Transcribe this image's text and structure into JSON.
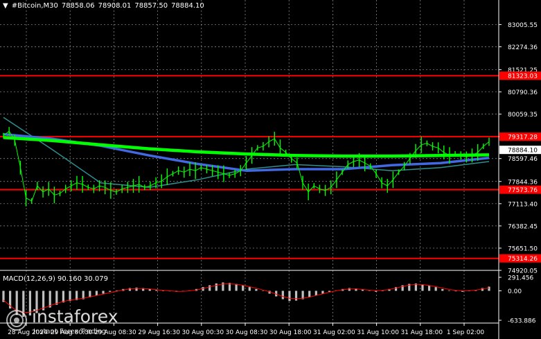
{
  "header": {
    "symbol": "#Bitcoin,M30",
    "open": "78858.06",
    "high": "78908.01",
    "low": "78857.50",
    "close": "78884.10"
  },
  "macd_header": {
    "name": "MACD(12,26,9)",
    "main": "90.160",
    "signal": "30.079"
  },
  "watermark": {
    "brand": "instaforex",
    "tagline": "Instant Forex Trading"
  },
  "colors": {
    "background": "#000000",
    "grid": "#ffffff",
    "price_line": "#00ff00",
    "level_line": "#ff0000",
    "level_label_bg": "#ff0000",
    "current_label_bg": "#ffffff",
    "ma_fast": "#00ff00",
    "ma_slow": "#4169e1",
    "ma_teal": "#2f8f8f",
    "macd_hist": "#c0c0c0",
    "macd_signal": "#ff0000"
  },
  "chart_data": [
    {
      "type": "line",
      "title": "#Bitcoin,M30",
      "ylim": [
        74920.05,
        83700
      ],
      "y_ticks": [
        "83005.55",
        "82274.36",
        "81521.25",
        "80790.36",
        "80059.35",
        "79317.28",
        "78597.46",
        "77844.36",
        "77113.40",
        "76382.45",
        "75651.50",
        "74920.05"
      ],
      "x_ticks": [
        "28 Aug 2024",
        "29 Aug 00:30",
        "29 Aug 08:30",
        "29 Aug 16:30",
        "30 Aug 00:30",
        "30 Aug 08:30",
        "30 Aug 18:00",
        "31 Aug 02:00",
        "31 Aug 10:00",
        "31 Aug 18:00",
        "1 Sep 02:00"
      ],
      "levels": [
        {
          "label": "81323.03",
          "value": 81323.03
        },
        {
          "label": "79317.28",
          "value": 79317.28
        },
        {
          "label": "77573.76",
          "value": 77573.76
        },
        {
          "label": "75314.26",
          "value": 75314.26
        }
      ],
      "current_price": {
        "label": "78884.10",
        "value": 78884.1
      },
      "series": [
        {
          "key": "price",
          "values": [
            79350,
            79500,
            79200,
            78300,
            77300,
            77200,
            77700,
            77500,
            77600,
            77400,
            77450,
            77600,
            77700,
            77800,
            77750,
            77650,
            77600,
            77700,
            77650,
            77550,
            77500,
            77600,
            77650,
            77700,
            77750,
            77650,
            77700,
            77800,
            77850,
            78000,
            78100,
            78200,
            78150,
            78250,
            78200,
            78300,
            78250,
            78200,
            78150,
            78100,
            78050,
            78100,
            78200,
            78450,
            78700,
            78950,
            79000,
            79150,
            79250,
            78950,
            78800,
            78600,
            78450,
            77800,
            77500,
            77700,
            77600,
            77550,
            77650,
            77900,
            78150,
            78400,
            78500,
            78550,
            78450,
            78350,
            78100,
            77800,
            77700,
            77900,
            78150,
            78350,
            78600,
            78850,
            79050,
            79100,
            79000,
            78950,
            78800,
            78700,
            78750,
            78700,
            78650,
            78700,
            78800,
            79000,
            79150
          ]
        },
        {
          "key": "ma_fast",
          "values": [
            79290,
            79190,
            79050,
            78920,
            78820,
            78750,
            78700,
            78680,
            78680,
            78700,
            78720
          ]
        },
        {
          "key": "ma_slow",
          "values": [
            79400,
            79250,
            79020,
            78700,
            78420,
            78200,
            78250,
            78250,
            78380,
            78450,
            78620
          ]
        },
        {
          "key": "ma_teal",
          "values": [
            79950,
            78900,
            77800,
            77650,
            77900,
            78250,
            78400,
            78330,
            78200,
            78300,
            78500
          ]
        }
      ]
    },
    {
      "type": "bar",
      "title": "MACD(12,26,9)",
      "ylim": [
        -633.886,
        291.456
      ],
      "y_ticks": [
        "291.456",
        "0.00",
        "-633.886"
      ],
      "series": [
        {
          "key": "histogram",
          "values": [
            -240,
            -380,
            -520,
            -560,
            -530,
            -480,
            -420,
            -360,
            -300,
            -250,
            -220,
            -200,
            -180,
            -140,
            -100,
            -60,
            -20,
            10,
            40,
            60,
            70,
            60,
            40,
            20,
            0,
            -10,
            -20,
            -10,
            10,
            40,
            80,
            120,
            160,
            180,
            170,
            150,
            120,
            80,
            40,
            0,
            -60,
            -120,
            -180,
            -220,
            -210,
            -180,
            -140,
            -100,
            -60,
            -20,
            10,
            40,
            60,
            50,
            30,
            0,
            -20,
            0,
            40,
            80,
            120,
            150,
            160,
            140,
            110,
            80,
            40,
            10,
            -10,
            -20,
            0,
            20,
            60,
            90
          ]
        },
        {
          "key": "signal",
          "values": [
            -200,
            -320,
            -430,
            -470,
            -460,
            -420,
            -370,
            -320,
            -270,
            -230,
            -200,
            -180,
            -160,
            -130,
            -100,
            -70,
            -40,
            -10,
            20,
            40,
            50,
            50,
            40,
            25,
            10,
            0,
            -10,
            -10,
            0,
            20,
            50,
            85,
            120,
            145,
            150,
            140,
            120,
            90,
            55,
            20,
            -20,
            -70,
            -120,
            -160,
            -170,
            -160,
            -135,
            -100,
            -65,
            -30,
            0,
            25,
            40,
            40,
            30,
            15,
            5,
            10,
            30,
            60,
            95,
            125,
            140,
            135,
            115,
            90,
            60,
            30,
            10,
            0,
            5,
            15,
            40,
            60
          ]
        }
      ]
    }
  ]
}
